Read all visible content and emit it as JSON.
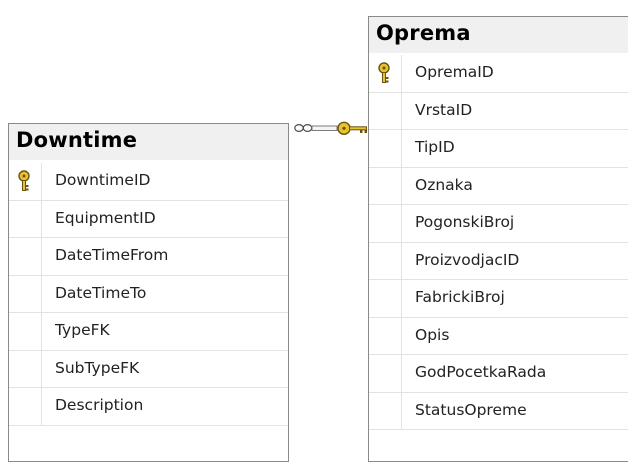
{
  "tables": [
    {
      "name": "Downtime",
      "primary_key": "DowntimeID",
      "columns": [
        {
          "name": "DowntimeID",
          "is_key": true
        },
        {
          "name": "EquipmentID",
          "is_key": false
        },
        {
          "name": "DateTimeFrom",
          "is_key": false
        },
        {
          "name": "DateTimeTo",
          "is_key": false
        },
        {
          "name": "TypeFK",
          "is_key": false
        },
        {
          "name": "SubTypeFK",
          "is_key": false
        },
        {
          "name": "Description",
          "is_key": false
        }
      ]
    },
    {
      "name": "Oprema",
      "primary_key": "OpremaID",
      "columns": [
        {
          "name": "OpremaID",
          "is_key": true
        },
        {
          "name": "VrstaID",
          "is_key": false
        },
        {
          "name": "TipID",
          "is_key": false
        },
        {
          "name": "Oznaka",
          "is_key": false
        },
        {
          "name": "PogonskiBroj",
          "is_key": false
        },
        {
          "name": "ProizvodjacID",
          "is_key": false
        },
        {
          "name": "FabrickiBroj",
          "is_key": false
        },
        {
          "name": "Opis",
          "is_key": false
        },
        {
          "name": "GodPocetkaRada",
          "is_key": false
        },
        {
          "name": "StatusOpreme",
          "is_key": false
        }
      ]
    }
  ],
  "relationship": {
    "from_table": "Downtime",
    "to_table": "Oprema",
    "from_cardinality": "many",
    "to_cardinality": "one",
    "from_symbol": "infinity-icon",
    "to_symbol": "key-icon"
  },
  "colors": {
    "header_bg": "#f0f0f0",
    "border": "#8a8a8a",
    "row_divider": "#e3e3e3",
    "key_gold": "#e8c230",
    "key_outline": "#6b5410"
  }
}
